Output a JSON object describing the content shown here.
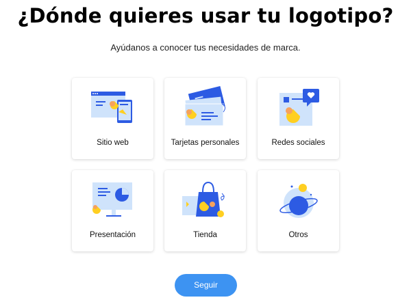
{
  "header": {
    "title": "¿Dónde quieres usar tu logotipo?",
    "subtitle": "Ayúdanos a conocer tus necesidades de marca."
  },
  "options": [
    {
      "label": "Sitio web",
      "icon": "website-icon"
    },
    {
      "label": "Tarjetas personales",
      "icon": "business-cards-icon"
    },
    {
      "label": "Redes sociales",
      "icon": "social-media-icon"
    },
    {
      "label": "Presentación",
      "icon": "presentation-icon"
    },
    {
      "label": "Tienda",
      "icon": "shopping-bag-icon"
    },
    {
      "label": "Otros",
      "icon": "planet-icon"
    }
  ],
  "footer": {
    "next_label": "Seguir"
  },
  "colors": {
    "accent": "#3d93f2",
    "illustration_blue": "#2d5be3",
    "illustration_light": "#cfe3fb",
    "illustration_yellow": "#ffcf21",
    "illustration_orange": "#f6a25d"
  }
}
